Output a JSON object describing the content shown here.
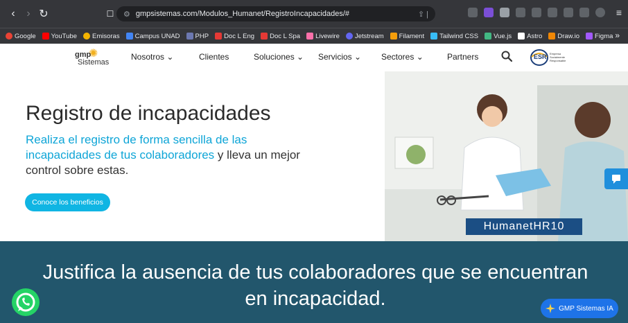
{
  "browser": {
    "url": "gmpsistemas.com/Modulos_Humanet/RegistroIncapacidades/#",
    "bookmarks": [
      {
        "label": "Google",
        "color": "#ea4335"
      },
      {
        "label": "YouTube",
        "color": "#ff0000"
      },
      {
        "label": "Emisoras",
        "color": "#f4b400"
      },
      {
        "label": "Campus UNAD",
        "color": "#4285f4"
      },
      {
        "label": "PHP",
        "color": "#6c78b0"
      },
      {
        "label": "Doc L Eng",
        "color": "#e53935"
      },
      {
        "label": "Doc L Spa",
        "color": "#e53935"
      },
      {
        "label": "Livewire",
        "color": "#fb70a9"
      },
      {
        "label": "Jetstream",
        "color": "#6366f1"
      },
      {
        "label": "Filament",
        "color": "#f59e0b"
      },
      {
        "label": "Tailwind CSS",
        "color": "#38bdf8"
      },
      {
        "label": "Vue.js",
        "color": "#42b883"
      },
      {
        "label": "Astro",
        "color": "#ffffff"
      },
      {
        "label": "Draw.io",
        "color": "#f08705"
      },
      {
        "label": "Figma",
        "color": "#a259ff"
      }
    ],
    "more": "»"
  },
  "header": {
    "logo_gmp": "gmp",
    "logo_sistemas": "Sistemas",
    "menu": [
      {
        "label": "Nosotros ⌄"
      },
      {
        "label": "Clientes"
      },
      {
        "label": "Soluciones ⌄"
      },
      {
        "label": "Servicios ⌄"
      },
      {
        "label": "Sectores ⌄"
      },
      {
        "label": "Partners"
      }
    ],
    "esr_label": "ESR",
    "esr_caption": "Empresa Socialmente Responsable"
  },
  "hero": {
    "title": "Registro de incapacidades",
    "sub_highlight": "Realiza el registro de forma sencilla de las incapacidades de tus colaboradores",
    "sub_rest": " y lleva un mejor control sobre estas.",
    "cta": "Conoce los beneficios",
    "badge": "HumanetHR10"
  },
  "band": {
    "text": "Justifica la ausencia de tus colaboradores que se encuentran en incapacidad."
  },
  "widgets": {
    "ia_button": "GMP Sistemas IA"
  },
  "colors": {
    "accent": "#10b5e3",
    "band": "#22566c",
    "badge": "#1b4e84"
  }
}
